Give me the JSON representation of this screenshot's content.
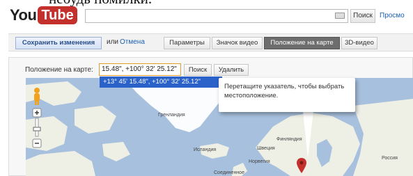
{
  "page_text_fragment": "небудь помилки.",
  "header": {
    "logo_you": "You",
    "logo_tube": "Tube",
    "search_placeholder": "",
    "search_button": "Поиск",
    "browse_link": "Просмо"
  },
  "toolbar": {
    "save_label": "Сохранить изменения",
    "or_text": "или",
    "cancel_label": "Отмена",
    "tabs": [
      {
        "label": "Параметры",
        "active": false
      },
      {
        "label": "Значок видео",
        "active": false
      },
      {
        "label": "Положение на карте",
        "active": true
      },
      {
        "label": "3D-видео",
        "active": false
      }
    ]
  },
  "location": {
    "label": "Положение на карте:",
    "value": "15.48\", +100° 32' 25.12\"",
    "search_button": "Поиск",
    "delete_button": "Удалить",
    "suggestion": "+13° 45' 15.48\", +100° 32' 25.12\""
  },
  "map": {
    "tooltip": "Перетащите указатель, чтобы выбрать местоположение.",
    "labels": {
      "greenland": "Гренландия",
      "iceland": "Исландия",
      "finland": "Финляндия",
      "sweden": "Швеция",
      "norway": "Норвегия",
      "uk": "Соединенное",
      "russia": "Россия"
    },
    "colors": {
      "water": "#a7c0de",
      "land": "#eef0e6",
      "ice": "#ffffff"
    }
  }
}
